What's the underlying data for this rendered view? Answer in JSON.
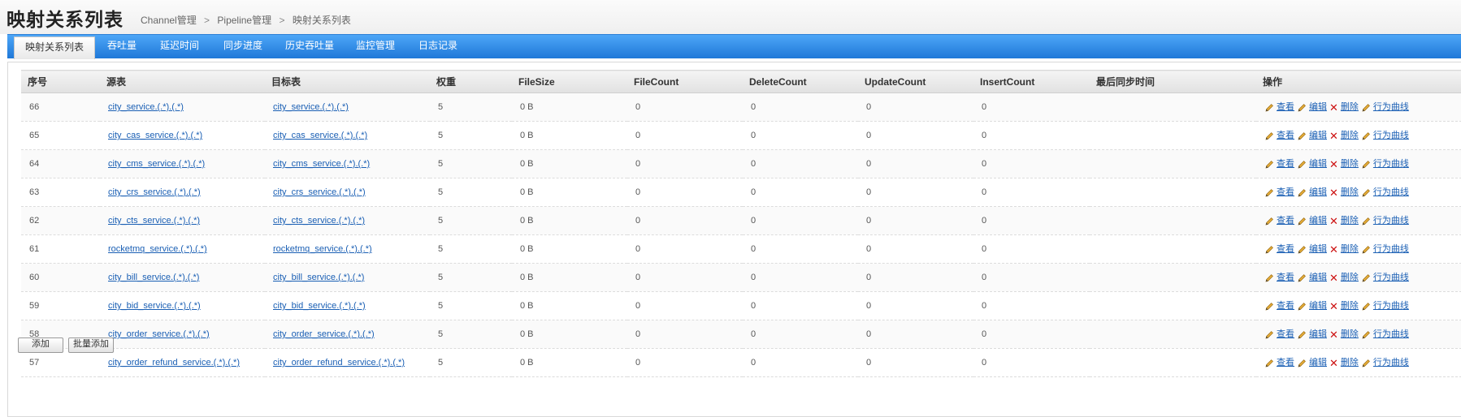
{
  "header": {
    "title": "映射关系列表",
    "breadcrumb": [
      "Channel管理",
      "Pipeline管理",
      "映射关系列表"
    ],
    "breadcrumb_sep": ">"
  },
  "tabs": [
    {
      "label": "映射关系列表",
      "active": true
    },
    {
      "label": "吞吐量"
    },
    {
      "label": "延迟时间"
    },
    {
      "label": "同步进度"
    },
    {
      "label": "历史吞吐量"
    },
    {
      "label": "监控管理"
    },
    {
      "label": "日志记录"
    }
  ],
  "table": {
    "columns": [
      "序号",
      "源表",
      "目标表",
      "权重",
      "FileSize",
      "FileCount",
      "DeleteCount",
      "UpdateCount",
      "InsertCount",
      "最后同步时间",
      "操作"
    ],
    "actions": {
      "view": "查看",
      "edit": "编辑",
      "delete": "删除",
      "curve": "行为曲线"
    },
    "rows": [
      {
        "id": "66",
        "source": "city_service.(.*).(.*)",
        "target": "city_service.(.*).(.*)",
        "weight": "5",
        "file_size": "0 B",
        "file_count": "0",
        "delete_count": "0",
        "update_count": "0",
        "insert_count": "0",
        "last_sync": ""
      },
      {
        "id": "65",
        "source": "city_cas_service.(.*).(.*)",
        "target": "city_cas_service.(.*).(.*)",
        "weight": "5",
        "file_size": "0 B",
        "file_count": "0",
        "delete_count": "0",
        "update_count": "0",
        "insert_count": "0",
        "last_sync": ""
      },
      {
        "id": "64",
        "source": "city_cms_service.(.*).(.*)",
        "target": "city_cms_service.(.*).(.*)",
        "weight": "5",
        "file_size": "0 B",
        "file_count": "0",
        "delete_count": "0",
        "update_count": "0",
        "insert_count": "0",
        "last_sync": ""
      },
      {
        "id": "63",
        "source": "city_crs_service.(.*).(.*)",
        "target": "city_crs_service.(.*).(.*)",
        "weight": "5",
        "file_size": "0 B",
        "file_count": "0",
        "delete_count": "0",
        "update_count": "0",
        "insert_count": "0",
        "last_sync": ""
      },
      {
        "id": "62",
        "source": "city_cts_service.(.*).(.*)",
        "target": "city_cts_service.(.*).(.*)",
        "weight": "5",
        "file_size": "0 B",
        "file_count": "0",
        "delete_count": "0",
        "update_count": "0",
        "insert_count": "0",
        "last_sync": ""
      },
      {
        "id": "61",
        "source": "rocketmq_service.(.*).(.*)",
        "target": "rocketmq_service.(.*).(.*)",
        "weight": "5",
        "file_size": "0 B",
        "file_count": "0",
        "delete_count": "0",
        "update_count": "0",
        "insert_count": "0",
        "last_sync": ""
      },
      {
        "id": "60",
        "source": "city_bill_service.(.*).(.*)",
        "target": "city_bill_service.(.*).(.*)",
        "weight": "5",
        "file_size": "0 B",
        "file_count": "0",
        "delete_count": "0",
        "update_count": "0",
        "insert_count": "0",
        "last_sync": ""
      },
      {
        "id": "59",
        "source": "city_bid_service.(.*).(.*)",
        "target": "city_bid_service.(.*).(.*)",
        "weight": "5",
        "file_size": "0 B",
        "file_count": "0",
        "delete_count": "0",
        "update_count": "0",
        "insert_count": "0",
        "last_sync": ""
      },
      {
        "id": "58",
        "source": "city_order_service.(.*).(.*)",
        "target": "city_order_service.(.*).(.*)",
        "weight": "5",
        "file_size": "0 B",
        "file_count": "0",
        "delete_count": "0",
        "update_count": "0",
        "insert_count": "0",
        "last_sync": ""
      },
      {
        "id": "57",
        "source": "city_order_refund_service.(.*).(.*)",
        "target": "city_order_refund_service.(.*).(.*)",
        "weight": "5",
        "file_size": "0 B",
        "file_count": "0",
        "delete_count": "0",
        "update_count": "0",
        "insert_count": "0",
        "last_sync": ""
      }
    ]
  },
  "buttons": {
    "add": "添加",
    "batch_add": "批量添加"
  },
  "colors": {
    "tab_bar": "#2f8ae6",
    "link": "#1a5fb4",
    "delete_icon": "#cc1111",
    "pencil_icon": "#e0a020"
  }
}
